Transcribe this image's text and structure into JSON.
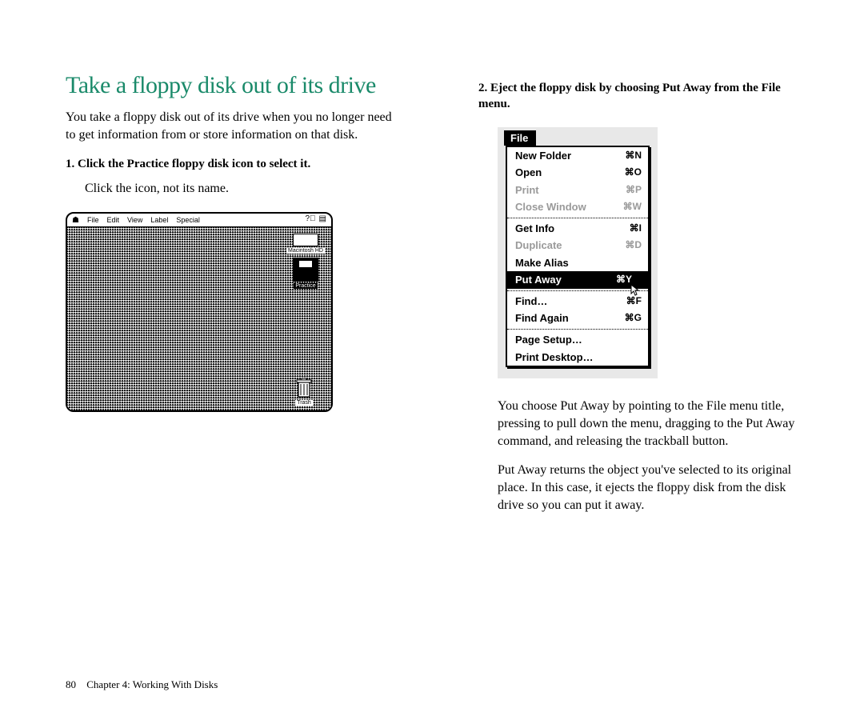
{
  "title": "Take a floppy disk out of its drive",
  "intro": "You take a floppy disk out of its drive when you no longer need to get information from or store information on that disk.",
  "step1": {
    "num": "1.",
    "heading": "Click the Practice floppy disk icon to select it.",
    "body": "Click the icon, not its name."
  },
  "desktop": {
    "menubar": [
      "File",
      "Edit",
      "View",
      "Label",
      "Special"
    ],
    "hd_label": "Macintosh HD",
    "floppy_label": "Practice",
    "trash_label": "Trash"
  },
  "step2": {
    "num": "2.",
    "heading": "Eject the floppy disk by choosing Put Away from the File menu."
  },
  "file_menu": {
    "title": "File",
    "groups": [
      [
        {
          "label": "New Folder",
          "shortcut": "⌘N",
          "dim": false
        },
        {
          "label": "Open",
          "shortcut": "⌘O",
          "dim": false
        },
        {
          "label": "Print",
          "shortcut": "⌘P",
          "dim": true
        },
        {
          "label": "Close Window",
          "shortcut": "⌘W",
          "dim": true
        }
      ],
      [
        {
          "label": "Get Info",
          "shortcut": "⌘I",
          "dim": false
        },
        {
          "label": "Duplicate",
          "shortcut": "⌘D",
          "dim": true
        },
        {
          "label": "Make Alias",
          "shortcut": "",
          "dim": false
        },
        {
          "label": "Put Away",
          "shortcut": "⌘Y",
          "dim": false,
          "selected": true
        }
      ],
      [
        {
          "label": "Find…",
          "shortcut": "⌘F",
          "dim": false
        },
        {
          "label": "Find Again",
          "shortcut": "⌘G",
          "dim": false
        }
      ],
      [
        {
          "label": "Page Setup…",
          "shortcut": "",
          "dim": false
        },
        {
          "label": "Print Desktop…",
          "shortcut": "",
          "dim": false
        }
      ]
    ]
  },
  "explain1": "You choose Put Away by pointing to the File menu title, pressing to pull down the menu, dragging to the Put Away command, and releasing the trackball button.",
  "explain2": "Put Away returns the object you've selected to its original place. In this case, it ejects the floppy disk from the disk drive so you can put it away.",
  "footer": {
    "page": "80",
    "chapter": "Chapter 4: Working With Disks"
  }
}
